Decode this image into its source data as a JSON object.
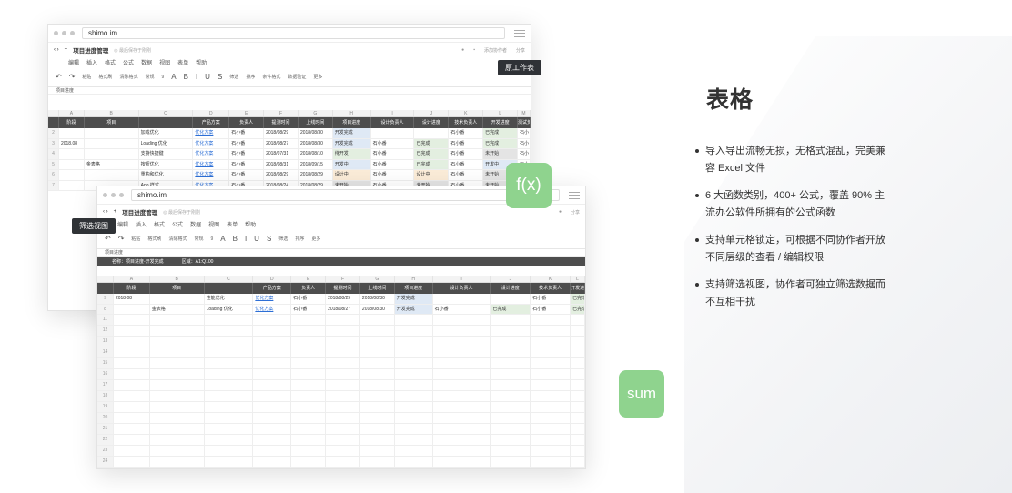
{
  "section": {
    "heading": "表格",
    "features": [
      "导入导出流畅无损，无格式混乱，完美兼容 Excel 文件",
      "6 大函数类别，400+ 公式，覆盖 90% 主流办公软件所拥有的公式函数",
      "支持单元格锁定，可根据不同协作者开放不同层级的查看 / 编辑权限",
      "支持筛选视图，协作者可独立筛选数据而不互相干扰"
    ]
  },
  "badges": {
    "fx": "f(x)",
    "sum": "sum"
  },
  "tooltips": {
    "original_sheet": "原工作表",
    "filter_view": "筛选视图"
  },
  "window": {
    "url": "shimo.im",
    "doc_title": "项目进度管理",
    "save_status": "◎ 最后保存于刚刚",
    "share": "分享",
    "collab": "添加协作者",
    "menu": [
      "编辑",
      "插入",
      "格式",
      "公式",
      "数据",
      "视图",
      "表单",
      "帮助"
    ],
    "toolbar": [
      "撤销",
      "重做",
      "粘贴",
      "格式刷",
      "清除格式",
      "常规",
      "9",
      "A",
      "B",
      "I",
      "U",
      "S",
      "条件格式",
      "数据验证",
      "筛选",
      "排序",
      "更多"
    ],
    "sheet_name": "项目进度",
    "columns": [
      "A",
      "B",
      "C",
      "D",
      "E",
      "F",
      "G",
      "H",
      "I",
      "J",
      "K",
      "L",
      "M"
    ],
    "headers": [
      "阶段",
      "项目",
      "",
      "产品方案",
      "负责人",
      "提测时间",
      "上线时间",
      "项目进度",
      "设计负责人",
      "设计进度",
      "技术负责人",
      "开发进度",
      "测试负责人"
    ],
    "rows": [
      [
        "",
        "",
        "加载优化",
        "优化方案",
        "石小番",
        "2018/08/29",
        "2018/08/30",
        "开发完成",
        "",
        "",
        "石小番",
        "已完成",
        "石小"
      ],
      [
        "2018.08",
        "",
        "Loading 优化",
        "优化方案",
        "石小番",
        "2018/08/27",
        "2018/08/30",
        "开发完成",
        "石小番",
        "已完成",
        "石小番",
        "已完成",
        "石小"
      ],
      [
        "",
        "",
        "支持快捷键",
        "优化方案",
        "石小番",
        "2018/07/31",
        "2018/08/10",
        "待开发",
        "石小番",
        "已完成",
        "石小番",
        "未开始",
        "石小"
      ],
      [
        "",
        "金表格",
        "按钮优化",
        "优化方案",
        "石小番",
        "2018/08/31",
        "2018/09/15",
        "开发中",
        "石小番",
        "已完成",
        "石小番",
        "开发中",
        "石小"
      ],
      [
        "",
        "",
        "重构和优化",
        "优化方案",
        "石小番",
        "2018/08/29",
        "2018/08/29",
        "设计中",
        "石小番",
        "设计中",
        "石小番",
        "未开始",
        "石小"
      ],
      [
        "",
        "",
        "App 样式",
        "优化方案",
        "石小番",
        "2018/08/24",
        "2018/08/29",
        "未开始",
        "石小番",
        "未开始",
        "石小番",
        "未开始",
        "石小"
      ]
    ],
    "filter_bar": {
      "name": "名称：项目进度-开发完成",
      "range": "区域：A1:Q100"
    },
    "filtered_rows": [
      [
        "2018.08",
        "",
        "性能优化",
        "优化方案",
        "石小番",
        "2018/08/29",
        "2018/08/30",
        "开发完成",
        "",
        "",
        "石小番",
        "已完成",
        "石小"
      ],
      [
        "",
        "金表格",
        "Loading 优化",
        "优化方案",
        "石小番",
        "2018/08/27",
        "2018/08/30",
        "开发完成",
        "石小番",
        "已完成",
        "石小番",
        "已完成",
        "石小"
      ]
    ],
    "filtered_row_numbers": [
      "9",
      "8"
    ],
    "empty_row_numbers": [
      "11",
      "12",
      "13",
      "14",
      "15",
      "16",
      "17",
      "18",
      "19",
      "20",
      "21",
      "22",
      "23",
      "24"
    ]
  }
}
